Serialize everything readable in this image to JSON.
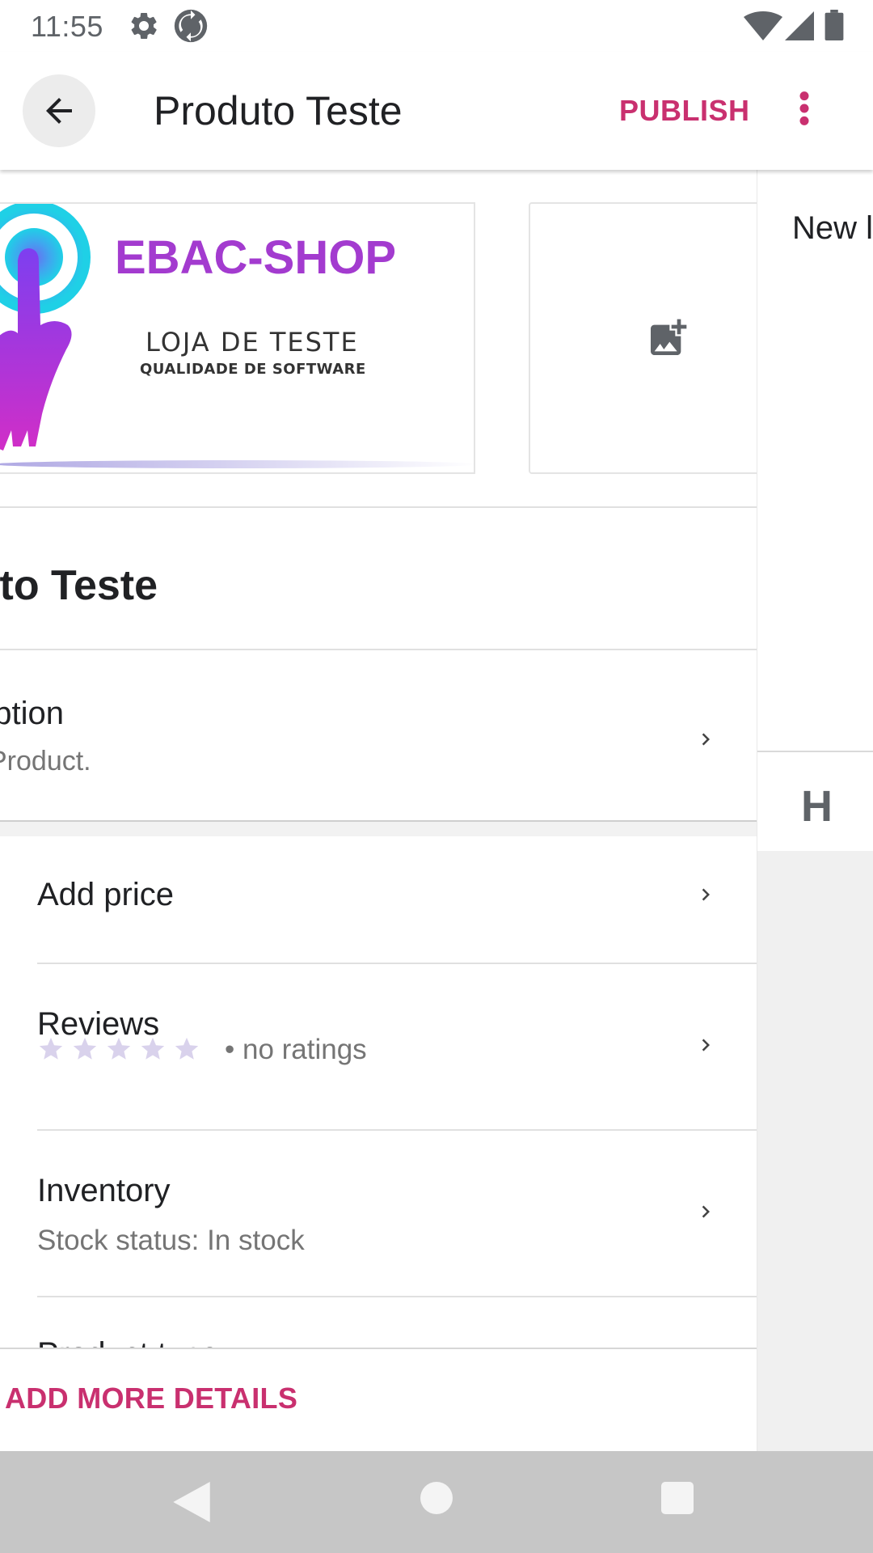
{
  "status_bar": {
    "time": "11:55",
    "icons": [
      "settings-icon",
      "sync-icon",
      "wifi-icon",
      "signal-icon",
      "battery-icon"
    ]
  },
  "app_bar": {
    "back_icon": "arrow-back-icon",
    "title": "Produto Teste",
    "publish_label": "PUBLISH",
    "more_icon": "more-vert-icon"
  },
  "images": {
    "product_image": {
      "brand": "EBAC-SHOP",
      "line1": "LOJA DE TESTE",
      "line2": "QUALIDADE DE SOFTWARE"
    },
    "add_image_icon": "add-photo-icon"
  },
  "product": {
    "name": "duto Teste"
  },
  "description": {
    "label": "ription",
    "value": "Product."
  },
  "rows": {
    "price": {
      "title": "Add price"
    },
    "reviews": {
      "title": "Reviews",
      "rating_text": "• no ratings",
      "stars_filled": 0,
      "stars_total": 5
    },
    "inventory": {
      "title": "Inventory",
      "subtitle": "Stock status: In stock"
    },
    "product_type": {
      "title": "Product type"
    }
  },
  "bottom": {
    "add_more_label": "ADD MORE DETAILS"
  },
  "side_pane": {
    "top_text": "New l",
    "toolbar_letter": "H"
  },
  "colors": {
    "accent": "#c9306f",
    "text_primary": "#202124",
    "text_secondary": "#757575",
    "star_empty": "#d9d2ec",
    "nav_bar": "#c6c6c6"
  }
}
